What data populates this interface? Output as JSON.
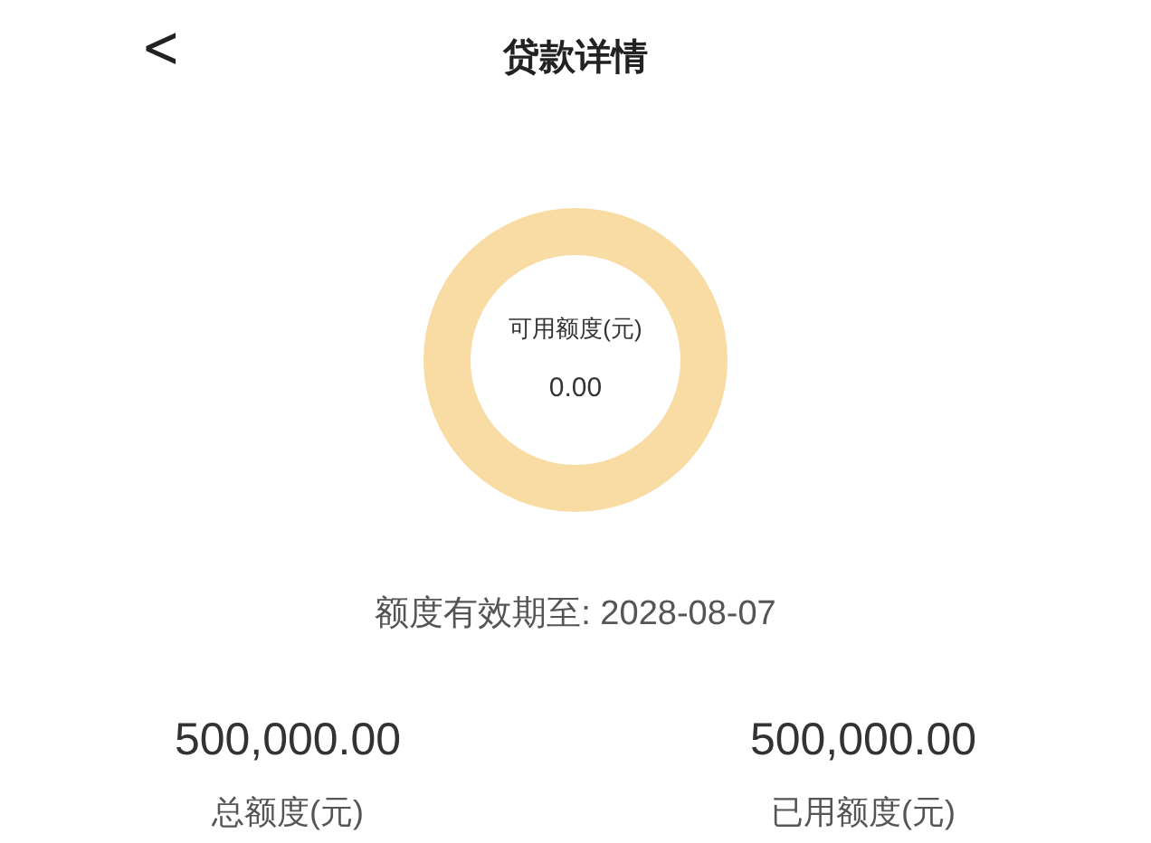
{
  "header": {
    "back": "<",
    "title": "贷款详情"
  },
  "ring": {
    "label": "可用额度(元)",
    "value": "0.00"
  },
  "validity": "额度有效期至: 2028-08-07",
  "totals": [
    {
      "amount": "500,000.00",
      "label": "总额度(元)"
    },
    {
      "amount": "500,000.00",
      "label": "已用额度(元)"
    }
  ]
}
